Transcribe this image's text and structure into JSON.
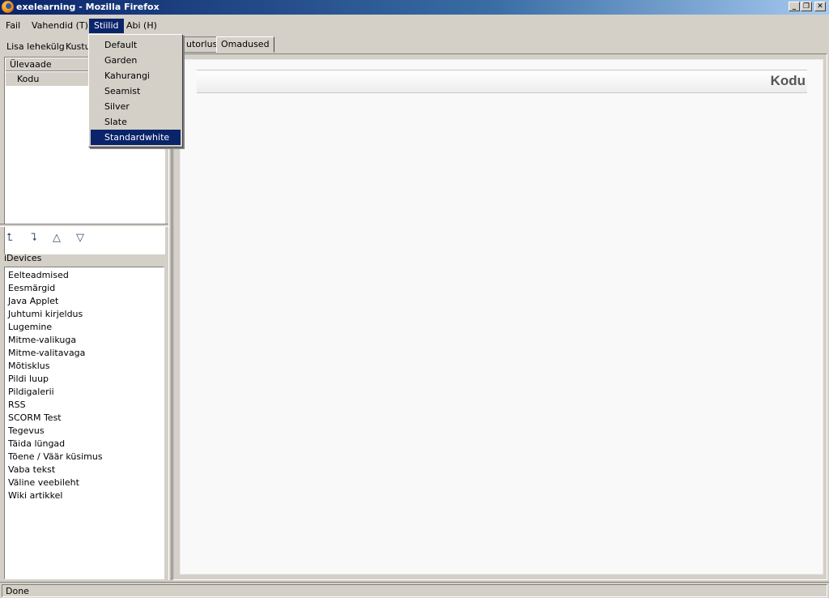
{
  "window": {
    "title": "exelearning - Mozilla Firefox",
    "buttons": {
      "minimize": "_",
      "restore": "❐",
      "close": "✕"
    }
  },
  "menubar": {
    "items": [
      {
        "label": "Fail"
      },
      {
        "label": "Vahendid (T)"
      },
      {
        "label": "Stiilid"
      },
      {
        "label": "Abi (H)"
      }
    ]
  },
  "styles_menu": {
    "items": [
      "Default",
      "Garden",
      "Kahurangi",
      "Seamist",
      "Silver",
      "Slate",
      "Standardwhite"
    ],
    "selected": "Standardwhite"
  },
  "left_toolbar": {
    "add_page": "Lisa lehekülg",
    "delete": "Kustu"
  },
  "outline": {
    "header": "Ülevaade",
    "nodes": [
      "Kodu"
    ]
  },
  "nav_arrows": [
    "promote-arrow-icon",
    "demote-arrow-icon",
    "move-up-icon",
    "move-down-icon"
  ],
  "idevices": {
    "label": "iDevices",
    "items": [
      "Eelteadmised",
      "Eesmärgid",
      "Java Applet",
      "Juhtumi kirjeldus",
      "Lugemine",
      "Mitme-valikuga",
      "Mitme-valitavaga",
      "Mõtisklus",
      "Pildi luup",
      "Pildigalerii",
      "RSS",
      "SCORM Test",
      "Tegevus",
      "Täida lüngad",
      "Tõene / Väär küsimus",
      "Vaba tekst",
      "Väline veebileht",
      "Wiki artikkel"
    ]
  },
  "tabs": [
    {
      "label": "utorlus",
      "active": true
    },
    {
      "label": "Omadused",
      "active": false
    }
  ],
  "content": {
    "page_title": "Kodu"
  },
  "statusbar": {
    "text": "Done"
  },
  "colors": {
    "selection": "#0a246a",
    "chrome": "#d4d0c8"
  }
}
